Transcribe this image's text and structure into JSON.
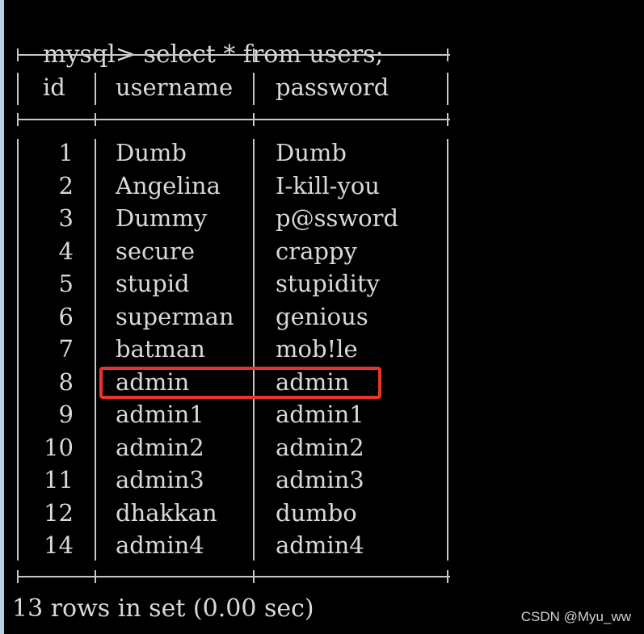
{
  "terminal": {
    "prompt": "mysql>",
    "command": "select * from users;",
    "footer": "13 rows in set (0.00 sec)"
  },
  "table": {
    "columns": [
      "id",
      "username",
      "password"
    ],
    "rows": [
      {
        "id": "1",
        "username": "Dumb",
        "password": "Dumb"
      },
      {
        "id": "2",
        "username": "Angelina",
        "password": "I-kill-you"
      },
      {
        "id": "3",
        "username": "Dummy",
        "password": "p@ssword"
      },
      {
        "id": "4",
        "username": "secure",
        "password": "crappy"
      },
      {
        "id": "5",
        "username": "stupid",
        "password": "stupidity"
      },
      {
        "id": "6",
        "username": "superman",
        "password": "genious"
      },
      {
        "id": "7",
        "username": "batman",
        "password": "mob!le"
      },
      {
        "id": "8",
        "username": "admin",
        "password": "admin"
      },
      {
        "id": "9",
        "username": "admin1",
        "password": "admin1"
      },
      {
        "id": "10",
        "username": "admin2",
        "password": "admin2"
      },
      {
        "id": "11",
        "username": "admin3",
        "password": "admin3"
      },
      {
        "id": "12",
        "username": "dhakkan",
        "password": "dumbo"
      },
      {
        "id": "14",
        "username": "admin4",
        "password": "admin4"
      }
    ],
    "highlighted_row_id": "8"
  },
  "watermark": "CSDN @Myu_ww",
  "colors": {
    "background": "#000000",
    "text": "#d9d9d9",
    "highlight": "#e8342a",
    "left_border": "#b9cde5"
  }
}
